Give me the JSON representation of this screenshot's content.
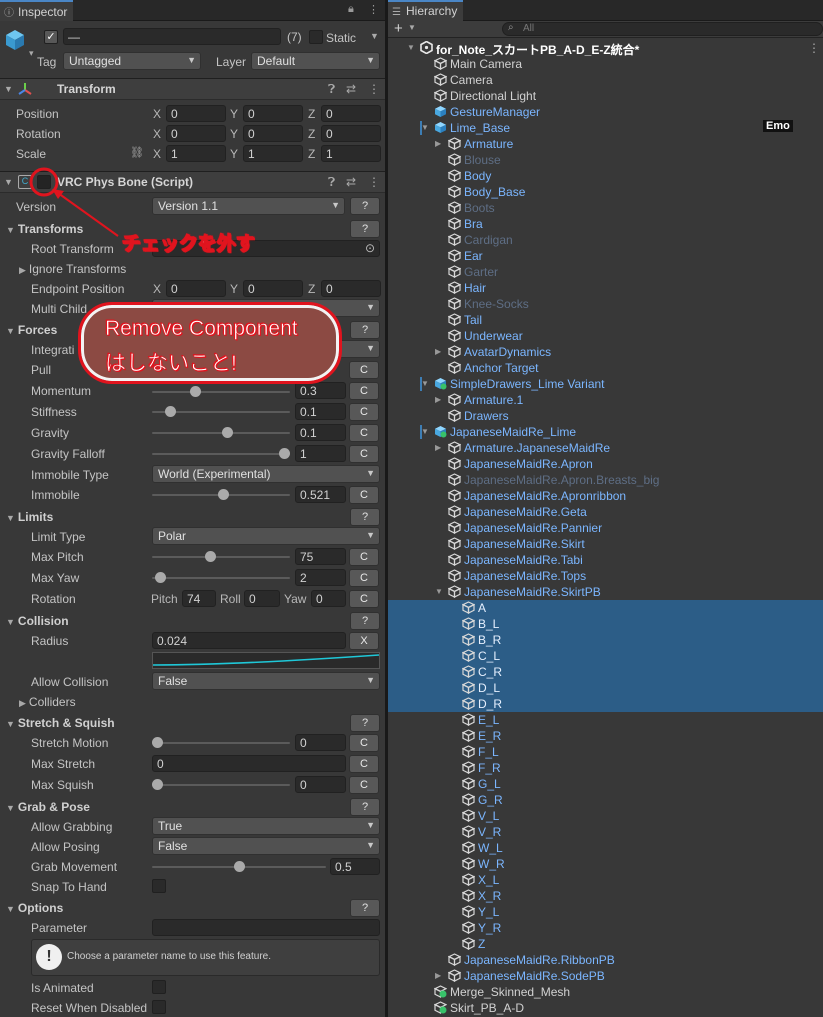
{
  "inspector": {
    "tab": "Inspector",
    "object_name": "—",
    "count": "(7)",
    "static_label": "Static",
    "tag_label": "Tag",
    "tag_value": "Untagged",
    "layer_label": "Layer",
    "layer_value": "Default",
    "transform": {
      "title": "Transform",
      "rows": [
        {
          "label": "Position",
          "x": "0",
          "y": "0",
          "z": "0"
        },
        {
          "label": "Rotation",
          "x": "0",
          "y": "0",
          "z": "0"
        },
        {
          "label": "Scale",
          "x": "1",
          "y": "1",
          "z": "1"
        }
      ]
    },
    "xyz": {
      "x": "X",
      "y": "Y",
      "z": "Z"
    },
    "component_title": "VRC Phys Bone (Script)",
    "help": "?",
    "c": "C",
    "x_btn": "X",
    "version": {
      "label": "Version",
      "value": "Version 1.1"
    },
    "transforms": {
      "title": "Transforms",
      "root_label": "Root Transform",
      "ignore_label": "Ignore Transforms",
      "endpoint_label": "Endpoint Position",
      "ex": "0",
      "ey": "0",
      "ez": "0",
      "multi_label": "Multi Child"
    },
    "forces": {
      "title": "Forces",
      "integration_label": "Integrati",
      "pull_label": "Pull",
      "momentum": {
        "label": "Momentum",
        "value": "0.3",
        "level": 0.3
      },
      "stiffness": {
        "label": "Stiffness",
        "value": "0.1",
        "level": 0.1
      },
      "gravity": {
        "label": "Gravity",
        "value": "0.1",
        "level": 0.55
      },
      "gravity_falloff": {
        "label": "Gravity Falloff",
        "value": "1",
        "level": 1.0
      },
      "immobile_type": {
        "label": "Immobile Type",
        "value": "World (Experimental)"
      },
      "immobile": {
        "label": "Immobile",
        "value": "0.521",
        "level": 0.521
      }
    },
    "limits": {
      "title": "Limits",
      "limit_type": {
        "label": "Limit Type",
        "value": "Polar"
      },
      "max_pitch": {
        "label": "Max Pitch",
        "value": "75",
        "level": 0.42
      },
      "max_yaw": {
        "label": "Max Yaw",
        "value": "2",
        "level": 0.02
      },
      "rotation": {
        "label": "Rotation",
        "pitch_l": "Pitch",
        "pitch": "74",
        "roll_l": "Roll",
        "roll": "0",
        "yaw_l": "Yaw",
        "yaw": "0"
      }
    },
    "collision": {
      "title": "Collision",
      "radius_label": "Radius",
      "radius": "0.024",
      "allow_label": "Allow Collision",
      "allow_value": "False",
      "colliders_label": "Colliders"
    },
    "stretch": {
      "title": "Stretch & Squish",
      "motion": {
        "label": "Stretch Motion",
        "value": "0",
        "level": 0
      },
      "max_stretch": {
        "label": "Max Stretch",
        "value": "0"
      },
      "max_squish": {
        "label": "Max Squish",
        "value": "0",
        "level": 0
      }
    },
    "grab": {
      "title": "Grab & Pose",
      "allow_grab": {
        "label": "Allow Grabbing",
        "value": "True"
      },
      "allow_pose": {
        "label": "Allow Posing",
        "value": "False"
      },
      "grab_move": {
        "label": "Grab Movement",
        "value": "0.5",
        "level": 0.5
      },
      "snap_label": "Snap To Hand"
    },
    "options": {
      "title": "Options",
      "param_label": "Parameter",
      "info": "Choose a parameter name to use this feature.",
      "animated_label": "Is Animated",
      "reset_label": "Reset When Disabled"
    },
    "annotation1": "チェックを外す",
    "annotation2_line1": "Remove Component",
    "annotation2_line2": "はしないこと!",
    "colors": {
      "annotation_red": "#e0141e",
      "bubble_fill": "#8c4a43",
      "curve": "#1fc8d8",
      "selected": "#2c5d87"
    }
  },
  "hierarchy": {
    "tab": "Hierarchy",
    "search_placeholder": "All",
    "emo_badge": "Emo",
    "items": [
      {
        "name": "for_Note_スカートPB_A-D_E-Z統合*",
        "depth": 0,
        "arrow": "▼",
        "style": "w",
        "icon": "unity"
      },
      {
        "name": "Main Camera",
        "depth": 1,
        "style": "n",
        "icon": "cube"
      },
      {
        "name": "Camera",
        "depth": 1,
        "style": "n",
        "icon": "cube"
      },
      {
        "name": "Directional Light",
        "depth": 1,
        "style": "n",
        "icon": "cube"
      },
      {
        "name": "GestureManager",
        "depth": 1,
        "style": "p",
        "icon": "prefab"
      },
      {
        "name": "Lime_Base",
        "depth": 1,
        "arrow": "▼",
        "style": "p",
        "icon": "prefab",
        "mark": true
      },
      {
        "name": "Armature",
        "depth": 2,
        "arrow": "▶",
        "style": "p",
        "icon": "cube"
      },
      {
        "name": "Blouse",
        "depth": 2,
        "style": "d",
        "icon": "cube"
      },
      {
        "name": "Body",
        "depth": 2,
        "style": "p",
        "icon": "cube"
      },
      {
        "name": "Body_Base",
        "depth": 2,
        "style": "p",
        "icon": "cube"
      },
      {
        "name": "Boots",
        "depth": 2,
        "style": "d",
        "icon": "cube"
      },
      {
        "name": "Bra",
        "depth": 2,
        "style": "p",
        "icon": "cube"
      },
      {
        "name": "Cardigan",
        "depth": 2,
        "style": "d",
        "icon": "cube"
      },
      {
        "name": "Ear",
        "depth": 2,
        "style": "p",
        "icon": "cube"
      },
      {
        "name": "Garter",
        "depth": 2,
        "style": "d",
        "icon": "cube"
      },
      {
        "name": "Hair",
        "depth": 2,
        "style": "p",
        "icon": "cube"
      },
      {
        "name": "Knee-Socks",
        "depth": 2,
        "style": "d",
        "icon": "cube"
      },
      {
        "name": "Tail",
        "depth": 2,
        "style": "p",
        "icon": "cube"
      },
      {
        "name": "Underwear",
        "depth": 2,
        "style": "p",
        "icon": "cube"
      },
      {
        "name": "AvatarDynamics",
        "depth": 2,
        "arrow": "▶",
        "style": "p",
        "icon": "cube"
      },
      {
        "name": "Anchor Target",
        "depth": 2,
        "style": "p",
        "icon": "cube"
      },
      {
        "name": "SimpleDrawers_Lime Variant",
        "depth": 1,
        "arrow": "▼",
        "style": "p",
        "icon": "variant",
        "mark": true
      },
      {
        "name": "Armature.1",
        "depth": 2,
        "arrow": "▶",
        "style": "p",
        "icon": "cube"
      },
      {
        "name": "Drawers",
        "depth": 2,
        "style": "p",
        "icon": "cube"
      },
      {
        "name": "JapaneseMaidRe_Lime",
        "depth": 1,
        "arrow": "▼",
        "style": "p",
        "icon": "variant",
        "mark": true
      },
      {
        "name": "Armature.JapaneseMaidRe",
        "depth": 2,
        "arrow": "▶",
        "style": "p",
        "icon": "cube"
      },
      {
        "name": "JapaneseMaidRe.Apron",
        "depth": 2,
        "style": "p",
        "icon": "cube"
      },
      {
        "name": "JapaneseMaidRe.Apron.Breasts_big",
        "depth": 2,
        "style": "d",
        "icon": "cube"
      },
      {
        "name": "JapaneseMaidRe.Apronribbon",
        "depth": 2,
        "style": "p",
        "icon": "cube"
      },
      {
        "name": "JapaneseMaidRe.Geta",
        "depth": 2,
        "style": "p",
        "icon": "cube"
      },
      {
        "name": "JapaneseMaidRe.Pannier",
        "depth": 2,
        "style": "p",
        "icon": "cube"
      },
      {
        "name": "JapaneseMaidRe.Skirt",
        "depth": 2,
        "style": "p",
        "icon": "cube"
      },
      {
        "name": "JapaneseMaidRe.Tabi",
        "depth": 2,
        "style": "p",
        "icon": "cube"
      },
      {
        "name": "JapaneseMaidRe.Tops",
        "depth": 2,
        "style": "p",
        "icon": "cube"
      },
      {
        "name": "JapaneseMaidRe.SkirtPB",
        "depth": 2,
        "arrow": "▼",
        "style": "p",
        "icon": "cube"
      },
      {
        "name": "A",
        "depth": 3,
        "style": "s",
        "icon": "cube",
        "selected": true
      },
      {
        "name": "B_L",
        "depth": 3,
        "style": "s",
        "icon": "cube",
        "selected": true
      },
      {
        "name": "B_R",
        "depth": 3,
        "style": "s",
        "icon": "cube",
        "selected": true
      },
      {
        "name": "C_L",
        "depth": 3,
        "style": "s",
        "icon": "cube",
        "selected": true
      },
      {
        "name": "C_R",
        "depth": 3,
        "style": "s",
        "icon": "cube",
        "selected": true
      },
      {
        "name": "D_L",
        "depth": 3,
        "style": "s",
        "icon": "cube",
        "selected": true
      },
      {
        "name": "D_R",
        "depth": 3,
        "style": "s",
        "icon": "cube",
        "selected": true
      },
      {
        "name": "E_L",
        "depth": 3,
        "style": "p",
        "icon": "cube"
      },
      {
        "name": "E_R",
        "depth": 3,
        "style": "p",
        "icon": "cube"
      },
      {
        "name": "F_L",
        "depth": 3,
        "style": "p",
        "icon": "cube"
      },
      {
        "name": "F_R",
        "depth": 3,
        "style": "p",
        "icon": "cube"
      },
      {
        "name": "G_L",
        "depth": 3,
        "style": "p",
        "icon": "cube"
      },
      {
        "name": "G_R",
        "depth": 3,
        "style": "p",
        "icon": "cube"
      },
      {
        "name": "V_L",
        "depth": 3,
        "style": "p",
        "icon": "cube"
      },
      {
        "name": "V_R",
        "depth": 3,
        "style": "p",
        "icon": "cube"
      },
      {
        "name": "W_L",
        "depth": 3,
        "style": "p",
        "icon": "cube"
      },
      {
        "name": "W_R",
        "depth": 3,
        "style": "p",
        "icon": "cube"
      },
      {
        "name": "X_L",
        "depth": 3,
        "style": "p",
        "icon": "cube"
      },
      {
        "name": "X_R",
        "depth": 3,
        "style": "p",
        "icon": "cube"
      },
      {
        "name": "Y_L",
        "depth": 3,
        "style": "p",
        "icon": "cube"
      },
      {
        "name": "Y_R",
        "depth": 3,
        "style": "p",
        "icon": "cube"
      },
      {
        "name": "Z",
        "depth": 3,
        "style": "p",
        "icon": "cube"
      },
      {
        "name": "JapaneseMaidRe.RibbonPB",
        "depth": 2,
        "style": "p",
        "icon": "cube"
      },
      {
        "name": "JapaneseMaidRe.SodePB",
        "depth": 2,
        "arrow": "▶",
        "style": "p",
        "icon": "cube"
      },
      {
        "name": "Merge_Skinned_Mesh",
        "depth": 1,
        "style": "n",
        "icon": "green"
      },
      {
        "name": "Skirt_PB_A-D",
        "depth": 1,
        "style": "n",
        "icon": "green"
      }
    ]
  }
}
